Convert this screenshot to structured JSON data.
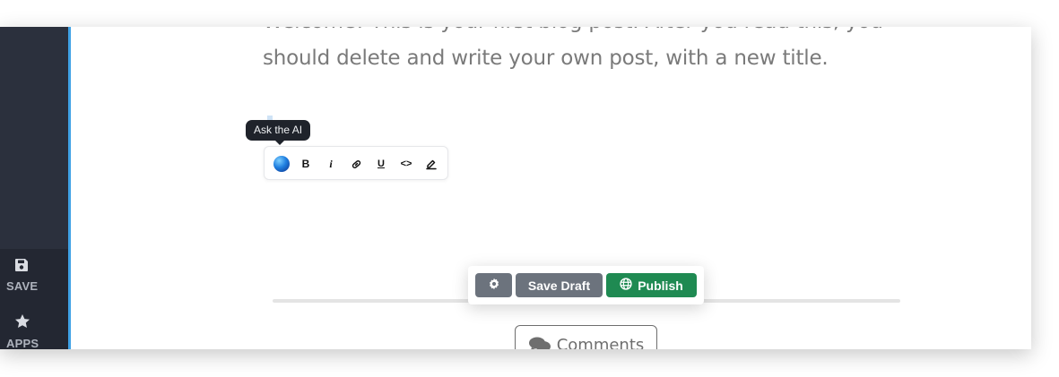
{
  "sidebar": {
    "items": [
      {
        "label": "SAVE",
        "icon": "save-icon"
      },
      {
        "label": "APPS",
        "icon": "star-icon"
      }
    ]
  },
  "editor": {
    "body_line_1": "Welcome! This is your first blog post. After you read this, you",
    "body_line_2": "should delete and write your own post, with a new title."
  },
  "tooltip": {
    "text": "Ask the AI"
  },
  "format_toolbar": {
    "buttons": [
      {
        "icon": "ai-orb-icon"
      },
      {
        "icon": "bold-icon",
        "glyph": "B"
      },
      {
        "icon": "italic-icon",
        "glyph": "i"
      },
      {
        "icon": "link-icon"
      },
      {
        "icon": "underline-icon",
        "glyph": "U"
      },
      {
        "icon": "code-icon",
        "glyph": "<>"
      },
      {
        "icon": "highlight-pen-icon"
      }
    ]
  },
  "actions": {
    "settings_icon": "gear-icon",
    "save_draft_label": "Save Draft",
    "publish_label": "Publish",
    "publish_icon": "globe-icon"
  },
  "comments": {
    "label": "Comments",
    "icon": "comments-icon"
  },
  "colors": {
    "sidebar": "#2b303d",
    "sidebar_bottom": "#232732",
    "accent": "#3fa2e6",
    "publish": "#1f8a52",
    "neutral_button": "#6c737d",
    "tooltip": "#1f232b",
    "body_text": "#7a7a7a"
  }
}
